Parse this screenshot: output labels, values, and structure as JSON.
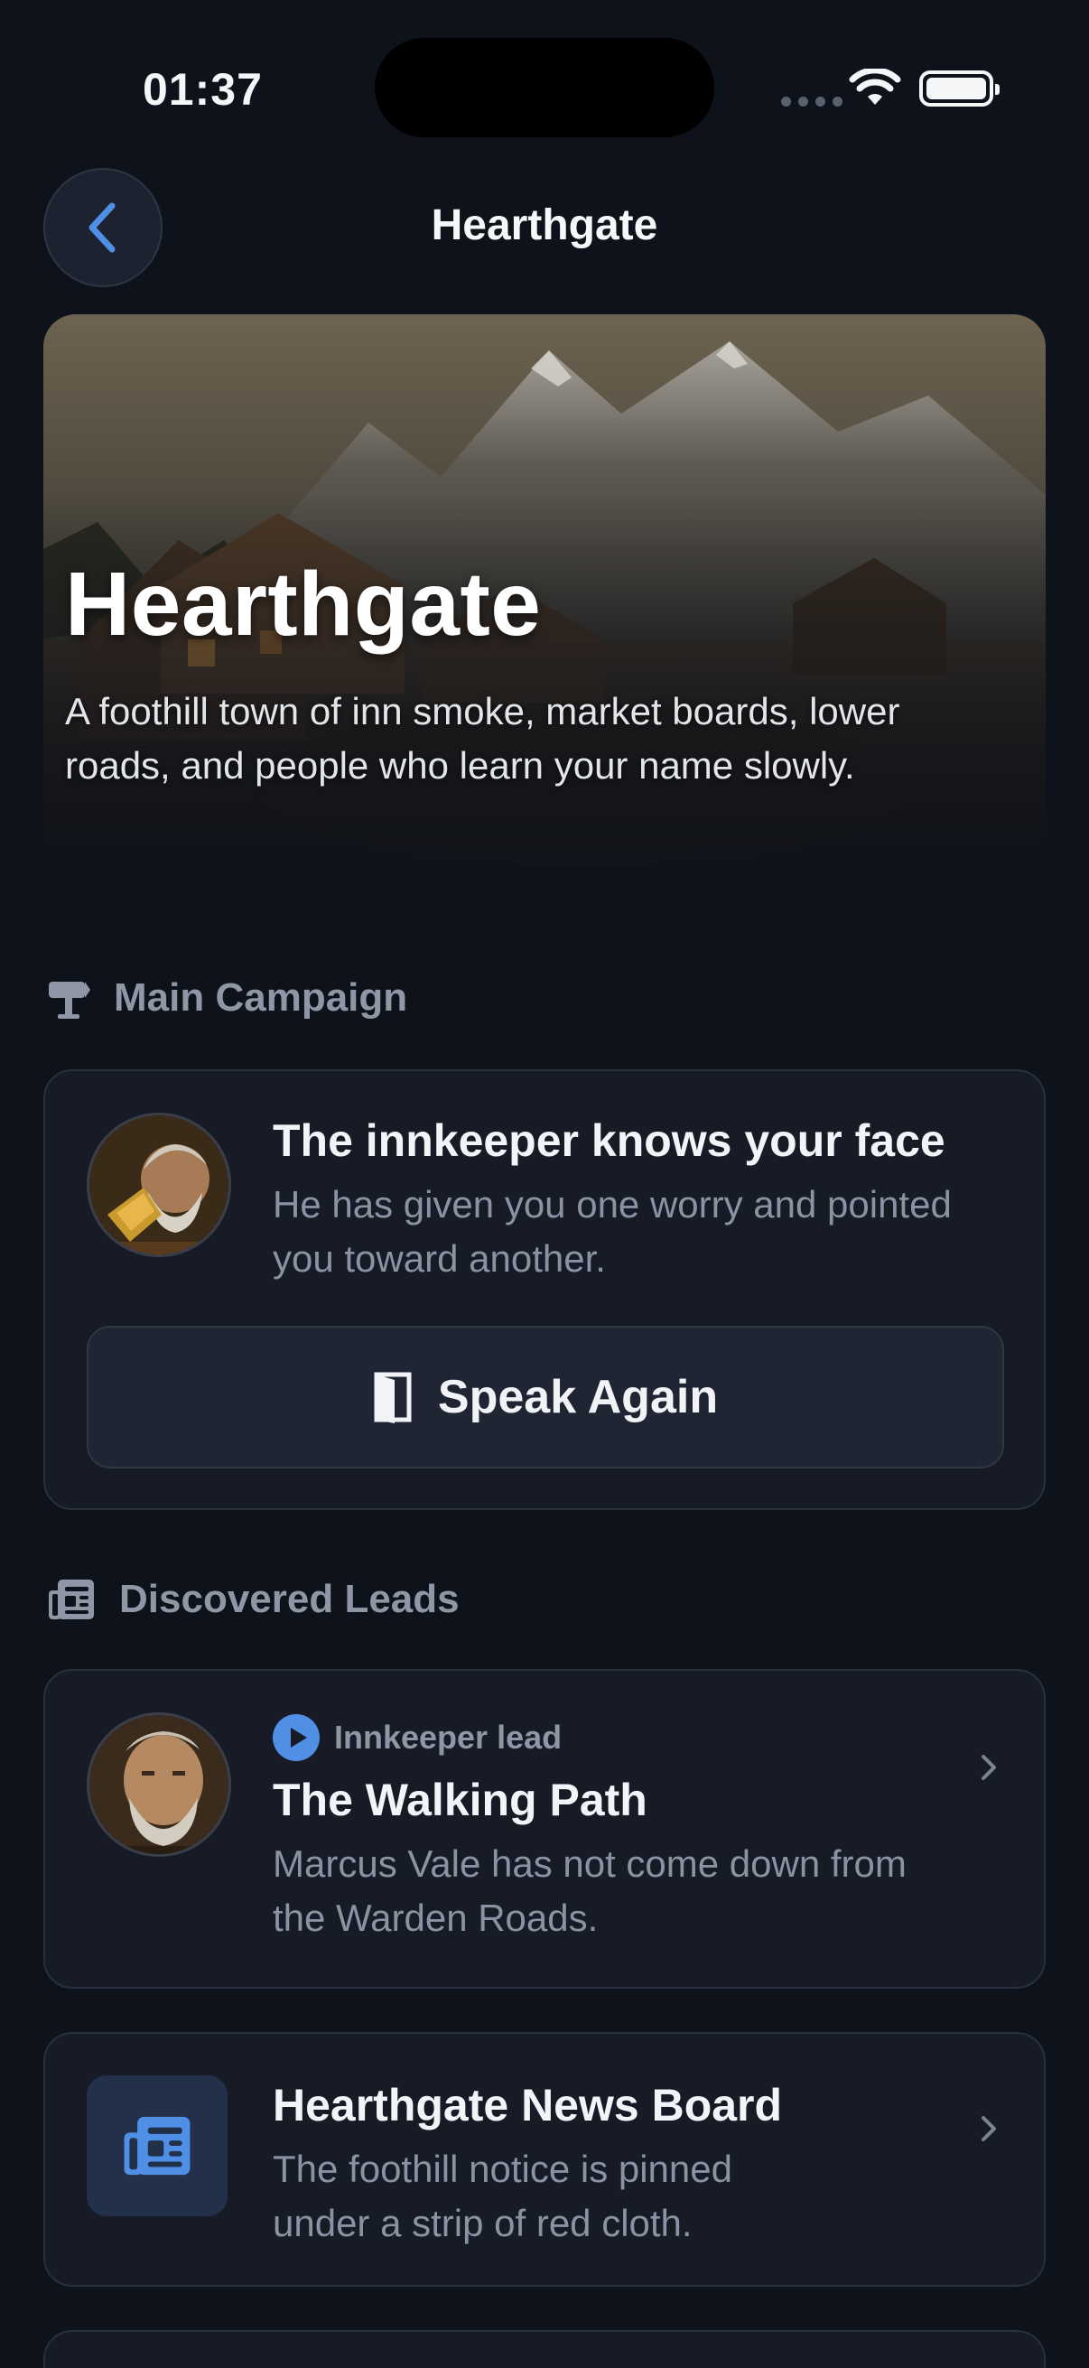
{
  "status_bar": {
    "time": "01:37",
    "icons": [
      "signal-dots-icon",
      "wifi-icon",
      "battery-icon"
    ]
  },
  "nav": {
    "back_icon": "chevron-left-icon",
    "title": "Hearthgate"
  },
  "hero": {
    "title": "Hearthgate",
    "subtitle": "A foothill town of inn smoke, market boards, lower roads, and people who learn your name slowly."
  },
  "main_campaign": {
    "header_icon": "signpost-icon",
    "header": "Main Campaign",
    "card": {
      "title": "The innkeeper knows your face",
      "description": "He has given you one worry and pointed you toward another.",
      "button_icon": "door-icon",
      "button_label": "Speak Again"
    }
  },
  "discovered_leads": {
    "header_icon": "newspaper-icon",
    "header": "Discovered Leads",
    "items": [
      {
        "badge_icon": "play-circle-icon",
        "badge": "Innkeeper lead",
        "title": "The Walking Path",
        "description": "Marcus Vale has not come down from the Warden Roads."
      },
      {
        "icon": "newspaper-icon",
        "title": "Hearthgate News Board",
        "description": "The foothill notice is pinned under a strip of red cloth."
      }
    ]
  },
  "colors": {
    "background": "#0e121a",
    "card": "#161b25",
    "accent": "#4f8fe6",
    "muted_text": "#8a93a3"
  }
}
